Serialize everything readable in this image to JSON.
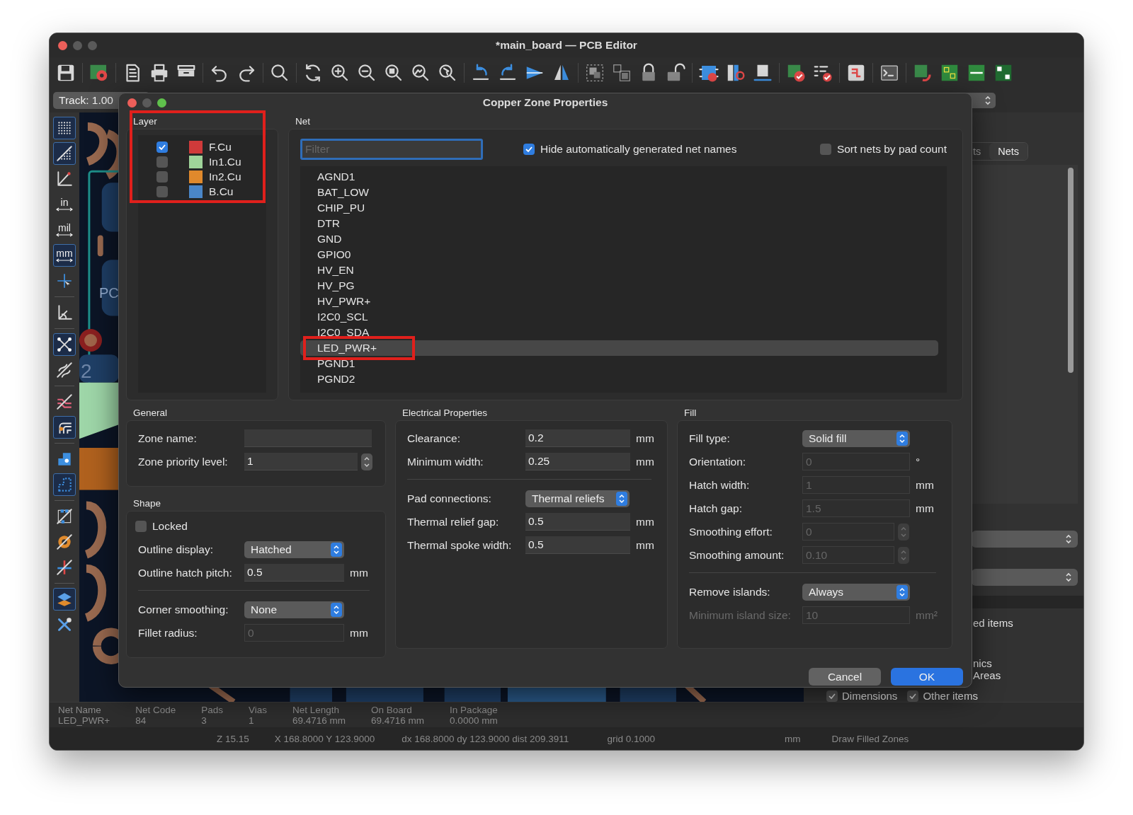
{
  "window": {
    "title": "*main_board — PCB Editor"
  },
  "track_selector": {
    "value": "Track: 1.00"
  },
  "left_toolbar": [
    {
      "kind": "grid",
      "selected": true
    },
    {
      "kind": "grid-overlay",
      "selected": true
    },
    {
      "kind": "polar",
      "selected": false
    },
    {
      "kind": "unit",
      "label": "in",
      "selected": false
    },
    {
      "kind": "unit",
      "label": "mil",
      "selected": false
    },
    {
      "kind": "unit",
      "label": "mm",
      "selected": true
    },
    {
      "kind": "cursor",
      "selected": false
    },
    {
      "kind": "sep"
    },
    {
      "kind": "origin",
      "selected": false
    },
    {
      "kind": "sep"
    },
    {
      "kind": "ratsnest",
      "selected": true
    },
    {
      "kind": "curved",
      "selected": false
    },
    {
      "kind": "sep"
    },
    {
      "kind": "tracks",
      "selected": false
    },
    {
      "kind": "pad-tracks",
      "selected": true
    },
    {
      "kind": "sep"
    },
    {
      "kind": "pad-shape",
      "selected": false
    },
    {
      "kind": "zone-outline",
      "selected": true
    },
    {
      "kind": "sep"
    },
    {
      "kind": "zone-fill",
      "selected": false
    },
    {
      "kind": "via",
      "selected": false
    },
    {
      "kind": "crossing",
      "selected": false
    },
    {
      "kind": "sep"
    },
    {
      "kind": "layers",
      "selected": true
    },
    {
      "kind": "tools",
      "selected": false
    }
  ],
  "canvas": {
    "labels": [
      "PC",
      "2"
    ]
  },
  "right_panel": {
    "tabs": [
      {
        "label": "ts",
        "selected": false
      },
      {
        "label": "Nets",
        "selected": true
      }
    ],
    "texts": [
      "ed items",
      "nics",
      "Areas"
    ],
    "checkboxes": [
      {
        "label": "Dimensions",
        "checked": true
      },
      {
        "label": "Other items",
        "checked": true
      }
    ]
  },
  "message_panel": {
    "columns": [
      {
        "heading": "Net Name",
        "value": "LED_PWR+"
      },
      {
        "heading": "Net Code",
        "value": "84"
      },
      {
        "heading": "Pads",
        "value": "3"
      },
      {
        "heading": "Vias",
        "value": "1"
      },
      {
        "heading": "Net Length",
        "value": "69.4716 mm"
      },
      {
        "heading": "On Board",
        "value": "69.4716 mm"
      },
      {
        "heading": "In Package",
        "value": "0.0000 mm"
      }
    ]
  },
  "status_bar": [
    "Z 15.15",
    "X 168.8000  Y 123.9000",
    "dx 168.8000  dy 123.9000  dist 209.3911",
    "grid 0.1000",
    "mm",
    "Draw Filled Zones"
  ],
  "dialog": {
    "title": "Copper Zone Properties",
    "layer": {
      "title": "Layer",
      "highlighted": true,
      "items": [
        {
          "name": "F.Cu",
          "checked": true,
          "color": "#d03a3a"
        },
        {
          "name": "In1.Cu",
          "checked": false,
          "color": "#9fd49a"
        },
        {
          "name": "In2.Cu",
          "checked": false,
          "color": "#e0892c"
        },
        {
          "name": "B.Cu",
          "checked": false,
          "color": "#4a86c8"
        }
      ]
    },
    "net": {
      "title": "Net",
      "filter": {
        "placeholder": "Filter"
      },
      "options": [
        {
          "label": "Hide automatically generated net names",
          "checked": true
        },
        {
          "label": "Sort nets by pad count",
          "checked": false
        }
      ],
      "items": [
        {
          "label": "AGND1",
          "selected": false,
          "highlighted": false
        },
        {
          "label": "BAT_LOW",
          "selected": false,
          "highlighted": false
        },
        {
          "label": "CHIP_PU",
          "selected": false,
          "highlighted": false
        },
        {
          "label": "DTR",
          "selected": false,
          "highlighted": false
        },
        {
          "label": "GND",
          "selected": false,
          "highlighted": false
        },
        {
          "label": "GPIO0",
          "selected": false,
          "highlighted": false
        },
        {
          "label": "HV_EN",
          "selected": false,
          "highlighted": false
        },
        {
          "label": "HV_PG",
          "selected": false,
          "highlighted": false
        },
        {
          "label": "HV_PWR+",
          "selected": false,
          "highlighted": false
        },
        {
          "label": "I2C0_SCL",
          "selected": false,
          "highlighted": false
        },
        {
          "label": "I2C0_SDA",
          "selected": false,
          "highlighted": false
        },
        {
          "label": "LED_PWR+",
          "selected": true,
          "highlighted": true
        },
        {
          "label": "PGND1",
          "selected": false,
          "highlighted": false
        },
        {
          "label": "PGND2",
          "selected": false,
          "highlighted": false
        }
      ]
    },
    "general": {
      "title": "General",
      "rows": [
        {
          "kind": "field",
          "label": "Zone name:",
          "value": "",
          "disabled": false
        },
        {
          "kind": "spin",
          "label": "Zone priority level:",
          "value": "1",
          "disabled": false
        }
      ]
    },
    "shape": {
      "title": "Shape",
      "rows": [
        {
          "kind": "check",
          "label": "Locked",
          "checked": false
        },
        {
          "kind": "select",
          "label": "Outline display:",
          "value": "Hatched"
        },
        {
          "kind": "field",
          "label": "Outline hatch pitch:",
          "value": "0.5",
          "unit": "mm",
          "disabled": false
        },
        {
          "kind": "divider"
        },
        {
          "kind": "select",
          "label": "Corner smoothing:",
          "value": "None"
        },
        {
          "kind": "field",
          "label": "Fillet radius:",
          "value": "0",
          "unit": "mm",
          "disabled": true
        }
      ]
    },
    "electrical": {
      "title": "Electrical Properties",
      "rows": [
        {
          "kind": "field",
          "label": "Clearance:",
          "value": "0.2",
          "unit": "mm",
          "disabled": false
        },
        {
          "kind": "field",
          "label": "Minimum width:",
          "value": "0.25",
          "unit": "mm",
          "disabled": false
        },
        {
          "kind": "divider"
        },
        {
          "kind": "select",
          "label": "Pad connections:",
          "value": "Thermal reliefs"
        },
        {
          "kind": "field",
          "label": "Thermal relief gap:",
          "value": "0.5",
          "unit": "mm",
          "disabled": false
        },
        {
          "kind": "field",
          "label": "Thermal spoke width:",
          "value": "0.5",
          "unit": "mm",
          "disabled": false
        }
      ]
    },
    "fill": {
      "title": "Fill",
      "rows": [
        {
          "kind": "select",
          "label": "Fill type:",
          "value": "Solid fill"
        },
        {
          "kind": "field",
          "label": "Orientation:",
          "value": "0",
          "unit": "°",
          "disabled": true
        },
        {
          "kind": "field",
          "label": "Hatch width:",
          "value": "1",
          "unit": "mm",
          "disabled": true
        },
        {
          "kind": "field",
          "label": "Hatch gap:",
          "value": "1.5",
          "unit": "mm",
          "disabled": true
        },
        {
          "kind": "spin",
          "label": "Smoothing effort:",
          "value": "0",
          "disabled": true
        },
        {
          "kind": "spin",
          "label": "Smoothing amount:",
          "value": "0.10",
          "disabled": true
        },
        {
          "kind": "divider"
        },
        {
          "kind": "select",
          "label": "Remove islands:",
          "value": "Always"
        },
        {
          "kind": "field",
          "label": "Minimum island size:",
          "value": "10",
          "unit": "mm²",
          "disabled": true,
          "label_disabled": true
        }
      ]
    },
    "buttons": [
      {
        "label": "Cancel",
        "primary": false
      },
      {
        "label": "OK",
        "primary": true
      }
    ]
  }
}
